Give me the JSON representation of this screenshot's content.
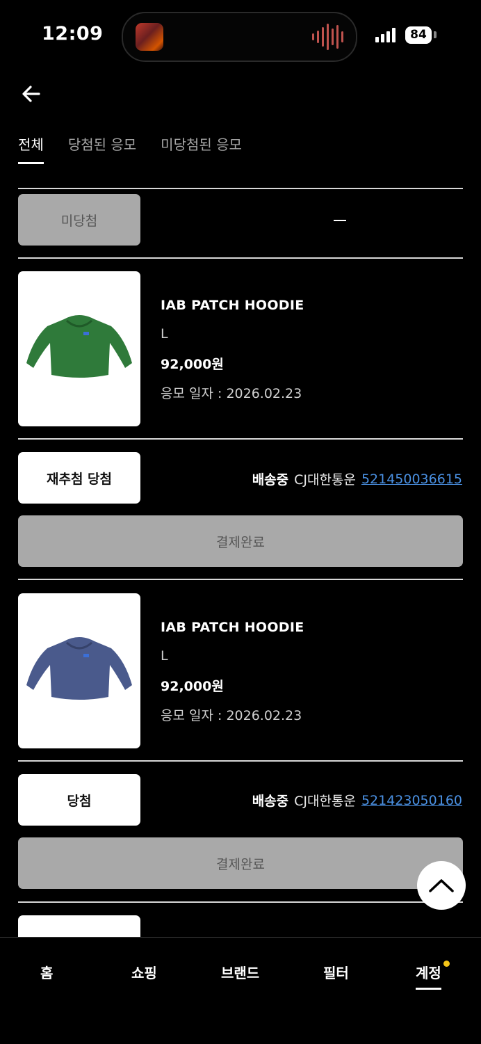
{
  "status_bar": {
    "time": "12:09",
    "battery": "84"
  },
  "tabs": [
    {
      "label": "전체",
      "active": true
    },
    {
      "label": "당첨된 응모",
      "active": false
    },
    {
      "label": "미당첨된 응모",
      "active": false
    }
  ],
  "first_entry": {
    "status_label": "미당첨",
    "dash": "—"
  },
  "entries": [
    {
      "name": "IAB PATCH HOODIE",
      "size": "L",
      "price": "92,000원",
      "date": "응모 일자 : 2026.02.23",
      "hoodie_color": "#2f7a3a",
      "status_label": "재추첨 당첨",
      "ship_status": "배송중",
      "courier": "CJ대한통운",
      "tracking": "521450036615",
      "payment": "결제완료"
    },
    {
      "name": "IAB PATCH HOODIE",
      "size": "L",
      "price": "92,000원",
      "date": "응모 일자 : 2026.02.23",
      "hoodie_color": "#4a5a8c",
      "status_label": "당첨",
      "ship_status": "배송중",
      "courier": "CJ대한통운",
      "tracking": "521423050160",
      "payment": "결제완료"
    }
  ],
  "bottom_nav": [
    {
      "label": "홈"
    },
    {
      "label": "쇼핑"
    },
    {
      "label": "브랜드"
    },
    {
      "label": "필터"
    },
    {
      "label": "계정",
      "active": true
    }
  ],
  "colors": {
    "link": "#4a90e2",
    "notification_dot": "#f5c518"
  }
}
